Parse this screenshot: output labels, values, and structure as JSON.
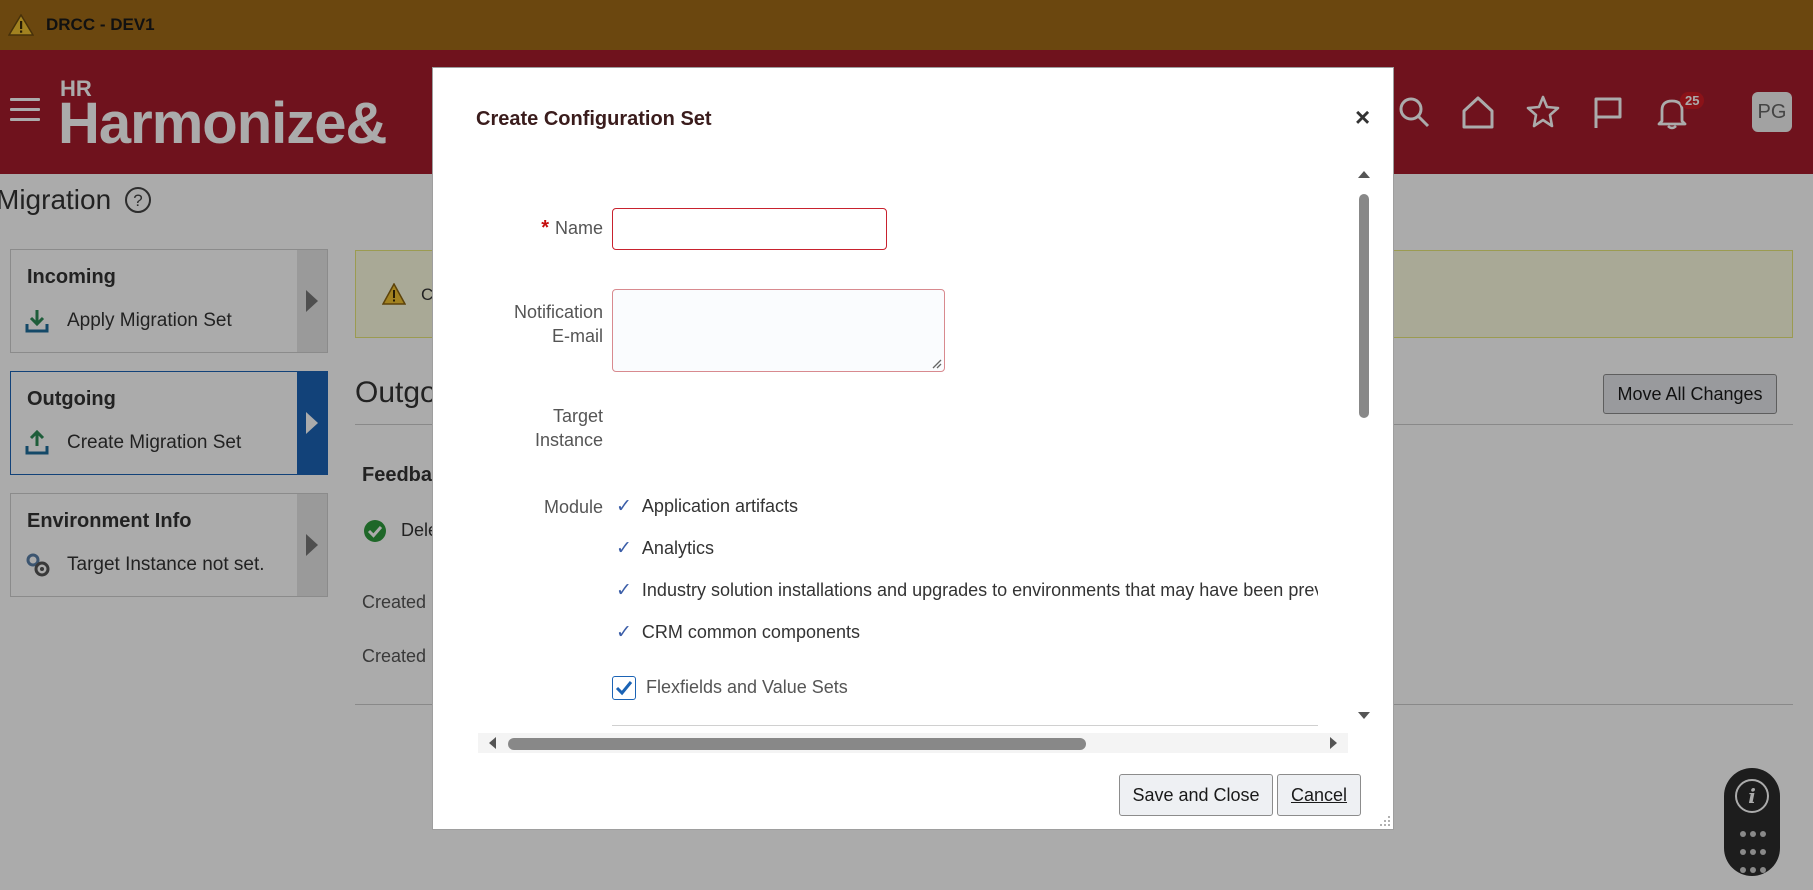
{
  "env": {
    "name": "DRCC - DEV1"
  },
  "header": {
    "logo_top": "HR",
    "logo_main": "Harmonize&",
    "notifications_count": "25",
    "user_initials": "PG"
  },
  "page": {
    "title": "Migration",
    "cards": [
      {
        "title": "Incoming",
        "action": "Apply Migration Set"
      },
      {
        "title": "Outgoing",
        "action": "Create Migration Set"
      },
      {
        "title": "Environment Info",
        "action": "Target Instance not set."
      }
    ],
    "alert_text": "C",
    "section_title": "Outgo",
    "move_all_label": "Move All Changes",
    "feedback_title": "Feedba",
    "feedback_item": "Dele",
    "created_1": "Created",
    "created_2": "Created"
  },
  "dialog": {
    "title": "Create Configuration Set",
    "close_symbol": "×",
    "fields": {
      "name_label": "Name",
      "name_required_marker": "*",
      "name_value": "",
      "email_label_line1": "Notification",
      "email_label_line2": "E-mail",
      "email_value": "",
      "target_label_line1": "Target",
      "target_label_line2": "Instance",
      "module_label": "Module"
    },
    "modules": [
      "Application artifacts",
      "Analytics",
      "Industry solution installations and upgrades to environments that may have been previc",
      "CRM common components"
    ],
    "flexfields": {
      "label": "Flexfields and Value Sets",
      "checked": true
    },
    "buttons": {
      "save_close": "Save and Close",
      "cancel": "Cancel"
    }
  },
  "colors": {
    "env_bar": "#a06a17",
    "header": "#a61c2c",
    "active_card": "#1b63b5",
    "required_border": "#c8222e"
  }
}
